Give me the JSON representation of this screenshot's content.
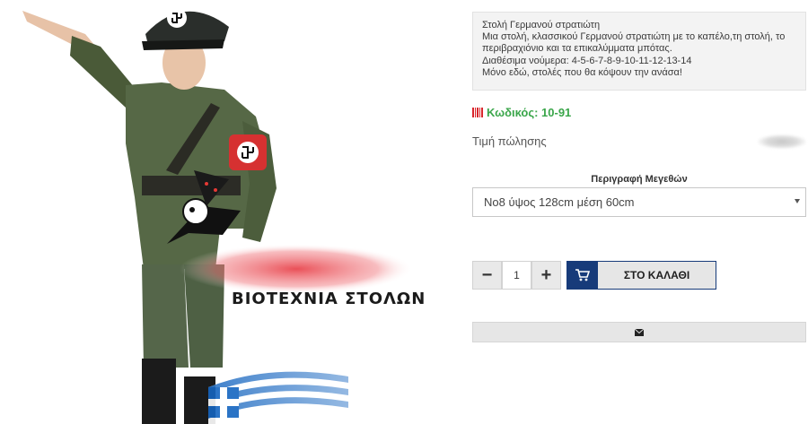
{
  "product": {
    "description_lines": [
      "Στολή Γερμανού στρατιώτη",
      "Μια στολή, κλασσικού Γερμανού στρατιώτη με το καπέλο,τη στολή, το",
      "περιβραχιόνιο και τα επικαλύμματα μπότας.",
      "Διαθέσιμα νούμερα: 4-5-6-7-8-9-10-11-12-13-14",
      "Μόνο εδώ, στολές που θα κόψουν την ανάσα!"
    ],
    "code_label": "Κωδικός: 10-91",
    "price_label": "Τιμή πώλησης",
    "sizes_label": "Περιγραφή Μεγεθών",
    "size_selected": "No8 ύψος 128cm μέση 60cm",
    "quantity": "1",
    "minus_label": "−",
    "plus_label": "+",
    "cart_label": "ΣΤΟ ΚΑΛΑΘΙ"
  },
  "image": {
    "watermark_text": "ΒΙΟΤΕΧΝΙΑ ΣΤΟΛΩΝ"
  },
  "colors": {
    "accent_navy": "#173b7a",
    "code_green": "#3aa64a",
    "code_icon_red": "#d9262c"
  },
  "icons": {
    "code": "barcode-icon",
    "cart": "cart-icon",
    "email": "envelope-icon",
    "select": "chevron-down-icon"
  }
}
